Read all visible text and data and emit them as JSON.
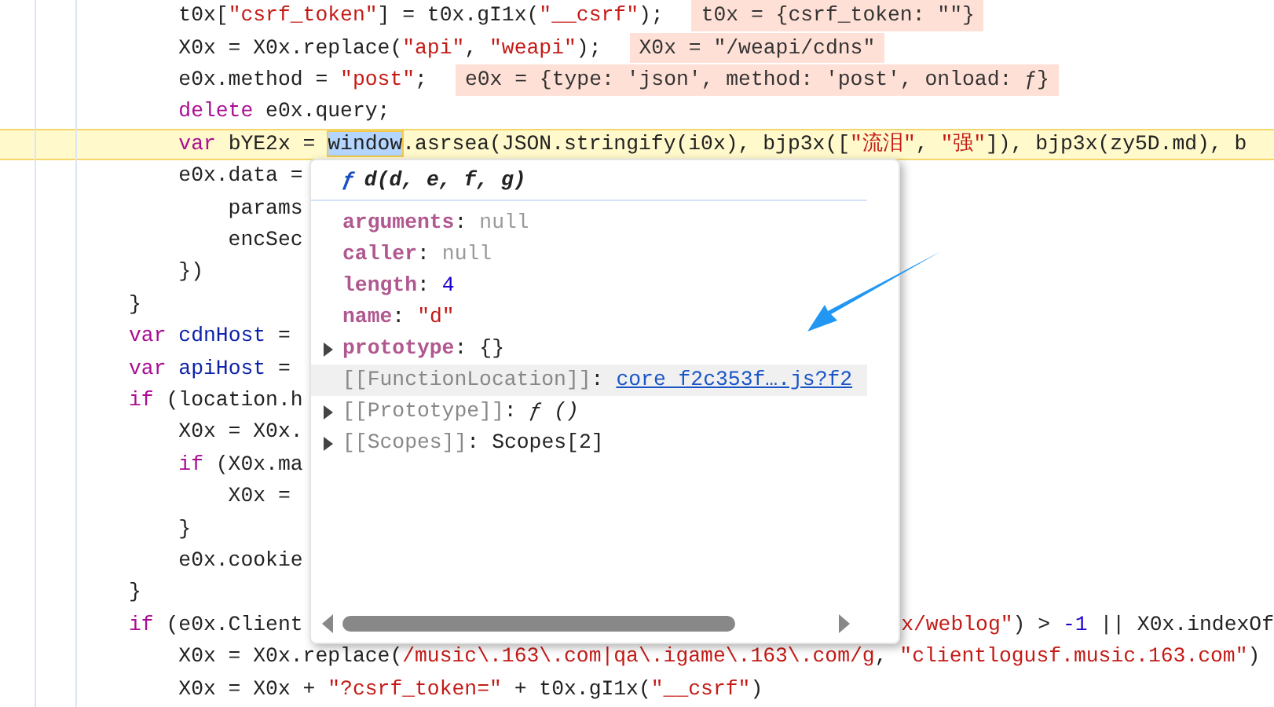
{
  "code_lines": [
    {
      "selected": false,
      "tokens": [
        {
          "kind": "plain",
          "text": "    t0x["
        },
        {
          "kind": "str",
          "text": "\"csrf_token\""
        },
        {
          "kind": "plain",
          "text": "] = t0x.gI1x("
        },
        {
          "kind": "str",
          "text": "\"__csrf\""
        },
        {
          "kind": "plain",
          "text": ");"
        }
      ],
      "hint": "t0x = {csrf_token: \"\"}"
    },
    {
      "selected": false,
      "tokens": [
        {
          "kind": "plain",
          "text": "    X0x = X0x.replace("
        },
        {
          "kind": "str",
          "text": "\"api\""
        },
        {
          "kind": "plain",
          "text": ", "
        },
        {
          "kind": "str",
          "text": "\"weapi\""
        },
        {
          "kind": "plain",
          "text": ");"
        }
      ],
      "hint": "X0x = \"/weapi/cdns\""
    },
    {
      "selected": false,
      "tokens": [
        {
          "kind": "plain",
          "text": "    e0x.method = "
        },
        {
          "kind": "str",
          "text": "\"post\""
        },
        {
          "kind": "plain",
          "text": ";"
        }
      ],
      "hint": "e0x = {type: 'json', method: 'post', onload: ƒ}"
    },
    {
      "selected": false,
      "tokens": [
        {
          "kind": "kw",
          "text": "    delete"
        },
        {
          "kind": "plain",
          "text": " e0x.query;"
        }
      ]
    },
    {
      "selected": true,
      "tokens": [
        {
          "kind": "kw",
          "text": "    var"
        },
        {
          "kind": "plain",
          "text": " bYE2x = "
        },
        {
          "kind": "selection",
          "text": "window"
        },
        {
          "kind": "plain",
          "text": ".asrsea(JSON.stringify(i0x), bjp3x(["
        },
        {
          "kind": "str",
          "text": "\"流泪\""
        },
        {
          "kind": "plain",
          "text": ", "
        },
        {
          "kind": "str",
          "text": "\"强\""
        },
        {
          "kind": "plain",
          "text": "]), bjp3x(zy5D.md), b"
        }
      ]
    },
    {
      "selected": false,
      "tokens": [
        {
          "kind": "plain",
          "text": "    e0x.data ="
        }
      ]
    },
    {
      "selected": false,
      "tokens": [
        {
          "kind": "plain",
          "text": "        params"
        }
      ]
    },
    {
      "selected": false,
      "tokens": [
        {
          "kind": "plain",
          "text": "        encSec"
        }
      ]
    },
    {
      "selected": false,
      "tokens": [
        {
          "kind": "plain",
          "text": "    })"
        }
      ]
    },
    {
      "selected": false,
      "tokens": [
        {
          "kind": "plain",
          "text": "}"
        }
      ]
    },
    {
      "selected": false,
      "tokens": [
        {
          "kind": "kw",
          "text": "var"
        },
        {
          "kind": "def",
          "text": " cdnHost"
        },
        {
          "kind": "plain",
          "text": " ="
        }
      ]
    },
    {
      "selected": false,
      "tokens": [
        {
          "kind": "kw",
          "text": "var"
        },
        {
          "kind": "def",
          "text": " apiHost"
        },
        {
          "kind": "plain",
          "text": " ="
        }
      ]
    },
    {
      "selected": false,
      "tokens": [
        {
          "kind": "kw",
          "text": "if"
        },
        {
          "kind": "plain",
          "text": " (location.h"
        }
      ]
    },
    {
      "selected": false,
      "tokens": [
        {
          "kind": "plain",
          "text": "    X0x = X0x."
        }
      ]
    },
    {
      "selected": false,
      "tokens": [
        {
          "kind": "kw",
          "text": "    if"
        },
        {
          "kind": "plain",
          "text": " (X0x.ma"
        }
      ]
    },
    {
      "selected": false,
      "tokens": [
        {
          "kind": "plain",
          "text": "        X0x ="
        }
      ]
    },
    {
      "selected": false,
      "tokens": [
        {
          "kind": "plain",
          "text": "    }"
        }
      ]
    },
    {
      "selected": false,
      "tokens": [
        {
          "kind": "plain",
          "text": "    e0x.cookie"
        }
      ]
    },
    {
      "selected": false,
      "tokens": [
        {
          "kind": "plain",
          "text": "}"
        }
      ]
    },
    {
      "selected": false,
      "tokens": [
        {
          "kind": "kw",
          "text": "if"
        },
        {
          "kind": "plain",
          "text": " (e0x.Client"
        }
      ],
      "tail_tokens": [
        {
          "kind": "str",
          "text": "x/weblog\""
        },
        {
          "kind": "plain",
          "text": ") > "
        },
        {
          "kind": "num",
          "text": "-1"
        },
        {
          "kind": "plain",
          "text": " || X0x.indexOf"
        }
      ]
    },
    {
      "selected": false,
      "tokens": [
        {
          "kind": "plain",
          "text": "    X0x = X0x.replace("
        },
        {
          "kind": "str",
          "text": "/music\\.163\\.com|qa\\.igame\\.163\\.com/g"
        },
        {
          "kind": "plain",
          "text": ", "
        },
        {
          "kind": "str",
          "text": "\"clientlogusf.music.163.com\""
        },
        {
          "kind": "plain",
          "text": ")"
        }
      ]
    },
    {
      "selected": false,
      "tokens": [
        {
          "kind": "plain",
          "text": "    X0x = X0x + "
        },
        {
          "kind": "str",
          "text": "\"?csrf_token=\""
        },
        {
          "kind": "plain",
          "text": " + t0x.gI1x("
        },
        {
          "kind": "str",
          "text": "\"__csrf\""
        },
        {
          "kind": "plain",
          "text": ")"
        }
      ]
    }
  ],
  "popup": {
    "function_mark": "ƒ",
    "signature": "d(d, e, f, g)",
    "rows": [
      {
        "name": "arguments",
        "separator": ":",
        "internal": false,
        "expandable": false,
        "selected": false,
        "value": "null",
        "kind": "null"
      },
      {
        "name": "caller",
        "separator": ":",
        "internal": false,
        "expandable": false,
        "selected": false,
        "value": "null",
        "kind": "null"
      },
      {
        "name": "length",
        "separator": ":",
        "internal": false,
        "expandable": false,
        "selected": false,
        "value": "4",
        "kind": "number"
      },
      {
        "name": "name",
        "separator": ":",
        "internal": false,
        "expandable": false,
        "selected": false,
        "value": "\"d\"",
        "kind": "string"
      },
      {
        "name": "prototype",
        "separator": ":",
        "internal": false,
        "expandable": true,
        "selected": false,
        "value": "{}",
        "kind": "plain"
      },
      {
        "name": "[[FunctionLocation]]",
        "separator": ":",
        "internal": true,
        "expandable": false,
        "selected": true,
        "value": "core f2c353f….js?f2",
        "kind": "link"
      },
      {
        "name": "[[Prototype]]",
        "separator": ":",
        "internal": true,
        "expandable": true,
        "selected": false,
        "value": "ƒ ()",
        "kind": "function"
      },
      {
        "name": "[[Scopes]]",
        "separator": ":",
        "internal": true,
        "expandable": true,
        "selected": false,
        "value": "Scopes[2]",
        "kind": "plain"
      }
    ]
  }
}
